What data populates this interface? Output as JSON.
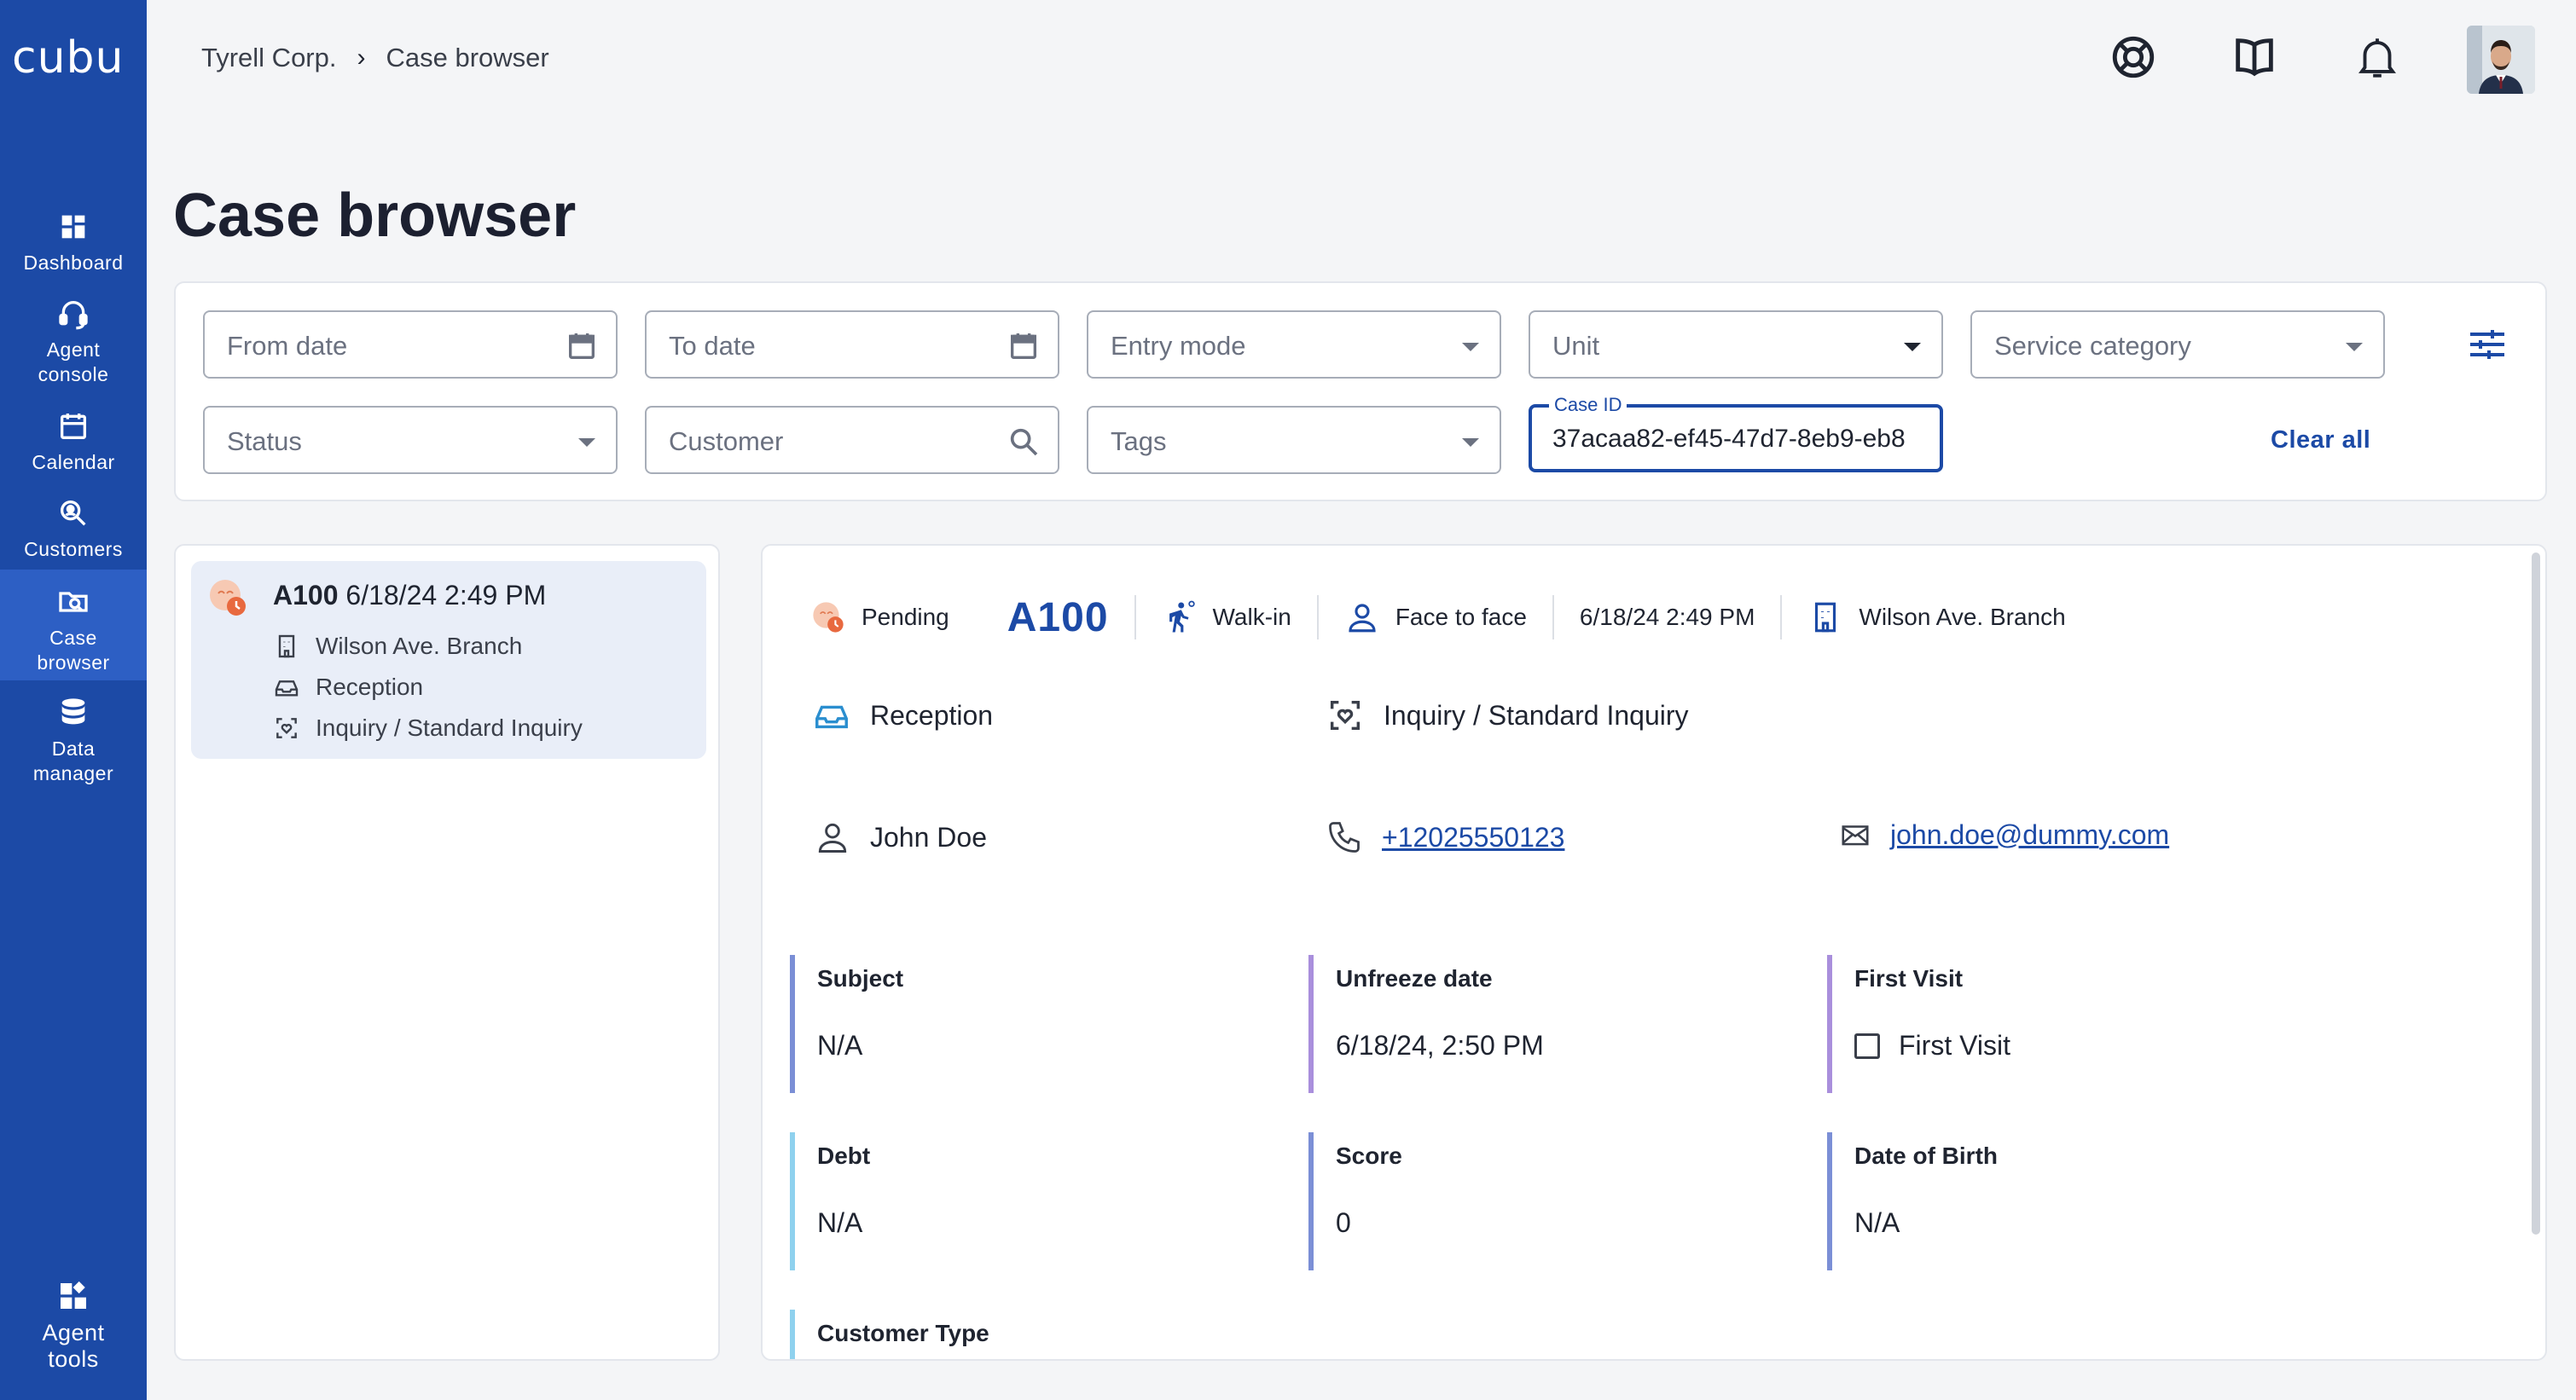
{
  "app": {
    "logo": "cubu"
  },
  "sidebar": {
    "items": [
      {
        "label": "Dashboard",
        "icon": "dashboard-icon",
        "active": false
      },
      {
        "label": "Agent console",
        "icon": "headset-icon",
        "active": false
      },
      {
        "label": "Calendar",
        "icon": "calendar-icon",
        "active": false
      },
      {
        "label": "Customers",
        "icon": "customers-search-icon",
        "active": false
      },
      {
        "label": "Case browser",
        "icon": "case-browser-icon",
        "active": true
      },
      {
        "label": "Data manager",
        "icon": "database-icon",
        "active": false
      }
    ],
    "bottom": {
      "label": "Agent tools",
      "icon": "agent-tools-icon"
    }
  },
  "breadcrumb": {
    "org": "Tyrell Corp.",
    "separator": "›",
    "page": "Case browser"
  },
  "topbar": {
    "icons": [
      "help-lifebuoy-icon",
      "book-icon",
      "bell-icon"
    ],
    "avatar": "user-avatar"
  },
  "page": {
    "title": "Case browser"
  },
  "filters": {
    "from_date": "From date",
    "to_date": "To date",
    "entry_mode": "Entry mode",
    "unit": "Unit",
    "service_category": "Service category",
    "status": "Status",
    "customer": "Customer",
    "tags": "Tags",
    "case_id_label": "Case ID",
    "case_id_value": "37acaa82-ef45-47d7-8eb9-eb8",
    "clear_all": "Clear all"
  },
  "case_list": [
    {
      "code": "A100",
      "datetime": "6/18/24 2:49 PM",
      "branch": "Wilson Ave. Branch",
      "unit": "Reception",
      "category": "Inquiry / Standard Inquiry"
    }
  ],
  "detail": {
    "status": "Pending",
    "code": "A100",
    "entry_mode": "Walk-in",
    "channel": "Face to face",
    "datetime": "6/18/24 2:49 PM",
    "branch": "Wilson Ave. Branch",
    "unit": "Reception",
    "category": "Inquiry / Standard Inquiry",
    "customer_name": "John Doe",
    "phone": "+12025550123",
    "email": "john.doe@dummy.com",
    "attributes": [
      {
        "label": "Subject",
        "value": "N/A",
        "color": "#7b8fd6"
      },
      {
        "label": "Unfreeze date",
        "value": "6/18/24, 2:50 PM",
        "color": "#a98fdc"
      },
      {
        "label": "First Visit",
        "value": "First Visit",
        "color": "#a98fdc",
        "checkbox": true,
        "checked": false
      },
      {
        "label": "Debt",
        "value": "N/A",
        "color": "#8fd1ee"
      },
      {
        "label": "Score",
        "value": "0",
        "color": "#7b8fd6"
      },
      {
        "label": "Date of Birth",
        "value": "N/A",
        "color": "#7b8fd6"
      },
      {
        "label": "Customer Type",
        "value": "",
        "color": "#8fd1ee"
      }
    ]
  },
  "colors": {
    "brand": "#1c4aa6",
    "active_nav": "#2d5fc4",
    "card_bg": "#e9eef8",
    "status_pending": "#f08a5d"
  }
}
